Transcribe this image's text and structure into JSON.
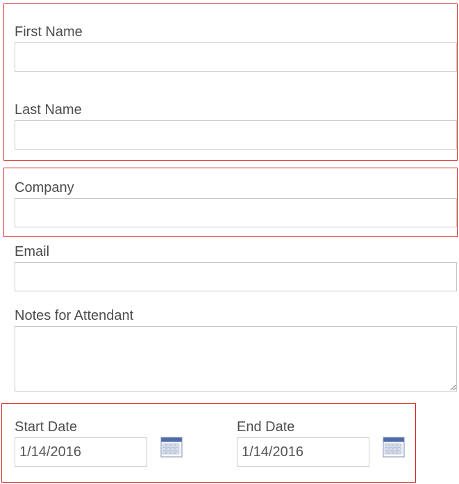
{
  "form": {
    "first_name": {
      "label": "First Name",
      "value": ""
    },
    "last_name": {
      "label": "Last Name",
      "value": ""
    },
    "company": {
      "label": "Company",
      "value": ""
    },
    "email": {
      "label": "Email",
      "value": ""
    },
    "notes": {
      "label": "Notes for Attendant",
      "value": ""
    },
    "start_date": {
      "label": "Start Date",
      "value": "1/14/2016"
    },
    "end_date": {
      "label": "End Date",
      "value": "1/14/2016"
    }
  },
  "icons": {
    "date_picker": "calendar-icon"
  },
  "colors": {
    "highlight_border": "#d61f1f",
    "field_border": "#c8c8c8",
    "label_text": "#4d4d4d"
  }
}
